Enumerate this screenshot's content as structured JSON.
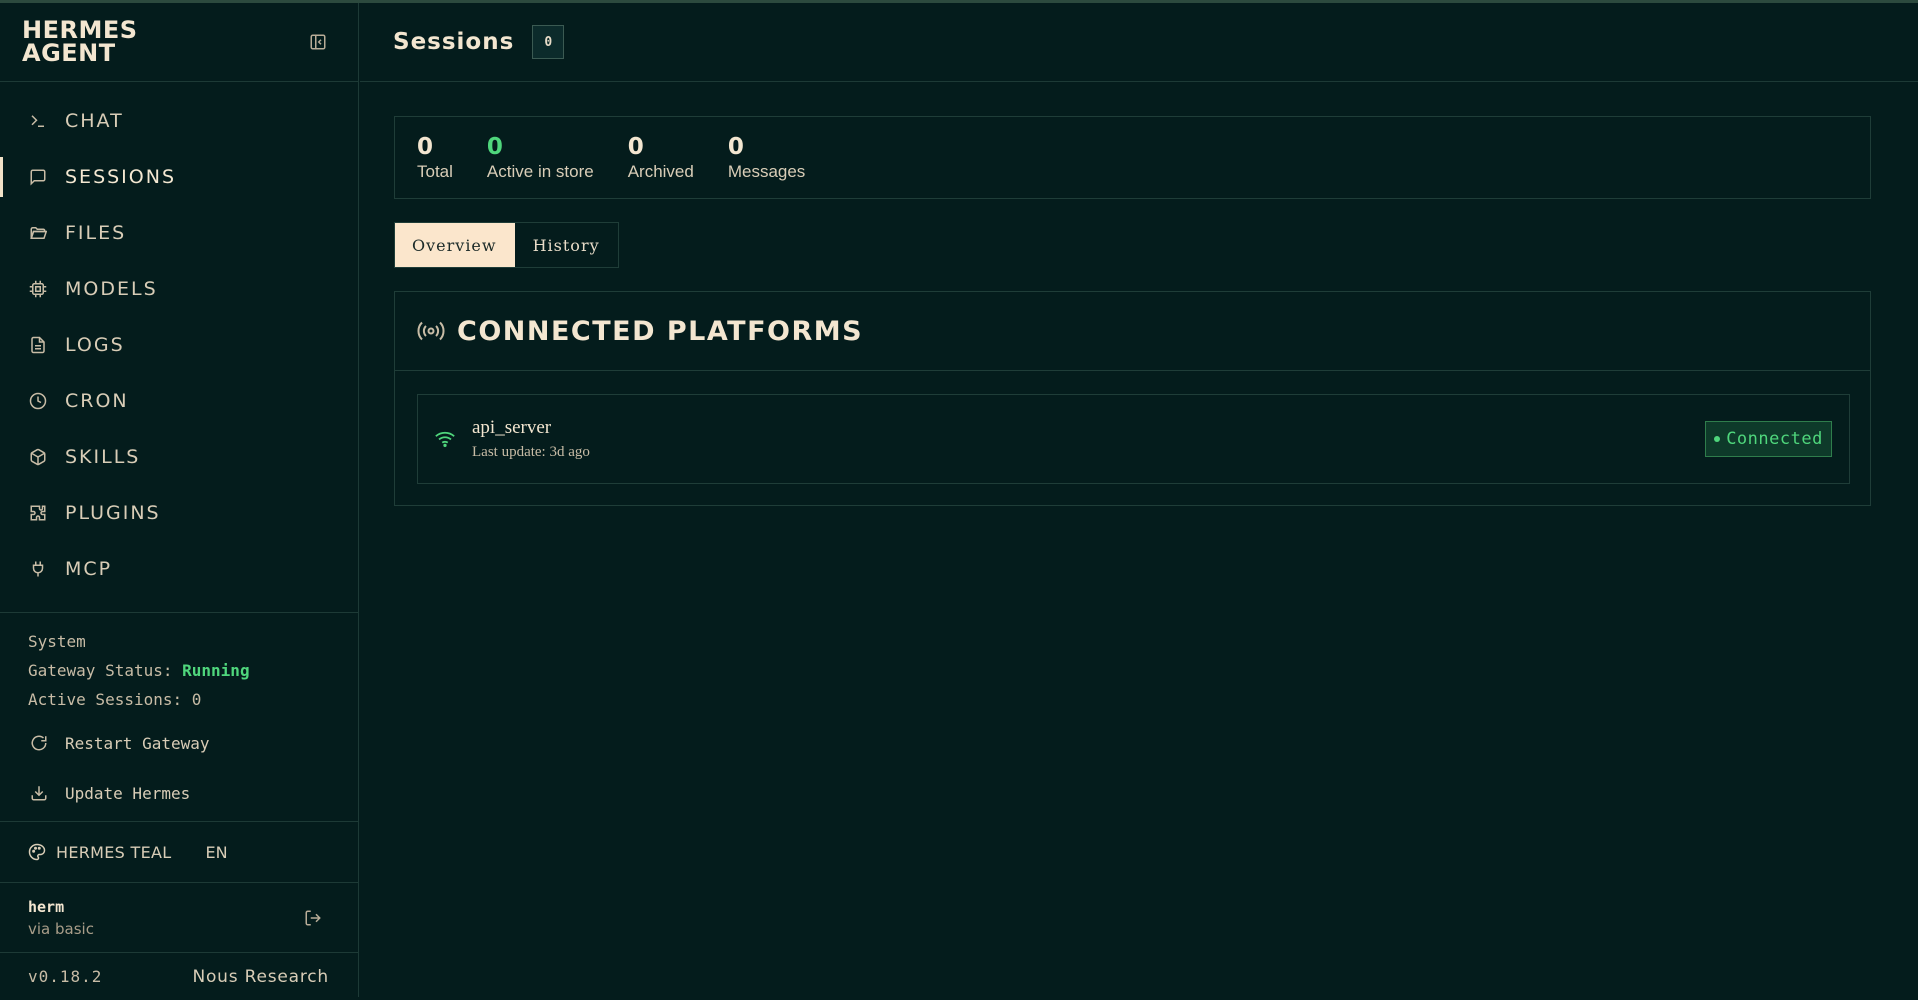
{
  "brand": {
    "line1": "HERMES",
    "line2": "AGENT"
  },
  "nav": {
    "items": [
      {
        "label": "CHAT",
        "icon": "terminal-icon"
      },
      {
        "label": "SESSIONS",
        "icon": "message-square-icon"
      },
      {
        "label": "FILES",
        "icon": "folder-open-icon"
      },
      {
        "label": "MODELS",
        "icon": "cpu-icon"
      },
      {
        "label": "LOGS",
        "icon": "file-text-icon"
      },
      {
        "label": "CRON",
        "icon": "clock-icon"
      },
      {
        "label": "SKILLS",
        "icon": "package-icon"
      },
      {
        "label": "PLUGINS",
        "icon": "puzzle-icon"
      },
      {
        "label": "MCP",
        "icon": "plug-icon"
      }
    ],
    "active": "SESSIONS"
  },
  "system": {
    "heading": "System",
    "gateway_label": "Gateway Status:",
    "gateway_value": "Running",
    "sessions_label": "Active Sessions:",
    "sessions_value": "0",
    "restart_label": "Restart Gateway",
    "update_label": "Update Hermes"
  },
  "theme": {
    "label": "HERMES TEAL",
    "lang": "EN"
  },
  "user": {
    "name": "herm",
    "auth": "via basic"
  },
  "footer": {
    "version": "v0.18.2",
    "org": "Nous Research"
  },
  "header": {
    "title": "Sessions",
    "count": "0"
  },
  "stats": [
    {
      "value": "0",
      "label": "Total",
      "accent": false
    },
    {
      "value": "0",
      "label": "Active in store",
      "accent": true
    },
    {
      "value": "0",
      "label": "Archived",
      "accent": false
    },
    {
      "value": "0",
      "label": "Messages",
      "accent": false
    }
  ],
  "tabs": [
    {
      "label": "Overview",
      "active": true
    },
    {
      "label": "History",
      "active": false
    }
  ],
  "platforms_panel": {
    "title": "CONNECTED PLATFORMS",
    "items": [
      {
        "name": "api_server",
        "updated": "Last update: 3d ago",
        "status": "Connected"
      }
    ]
  },
  "colors": {
    "background": "#041c1c",
    "border": "#1d3a36",
    "text": "#e8dcc8",
    "accent_green": "#4fd67c",
    "active_tab_bg": "#fbe6cc"
  }
}
